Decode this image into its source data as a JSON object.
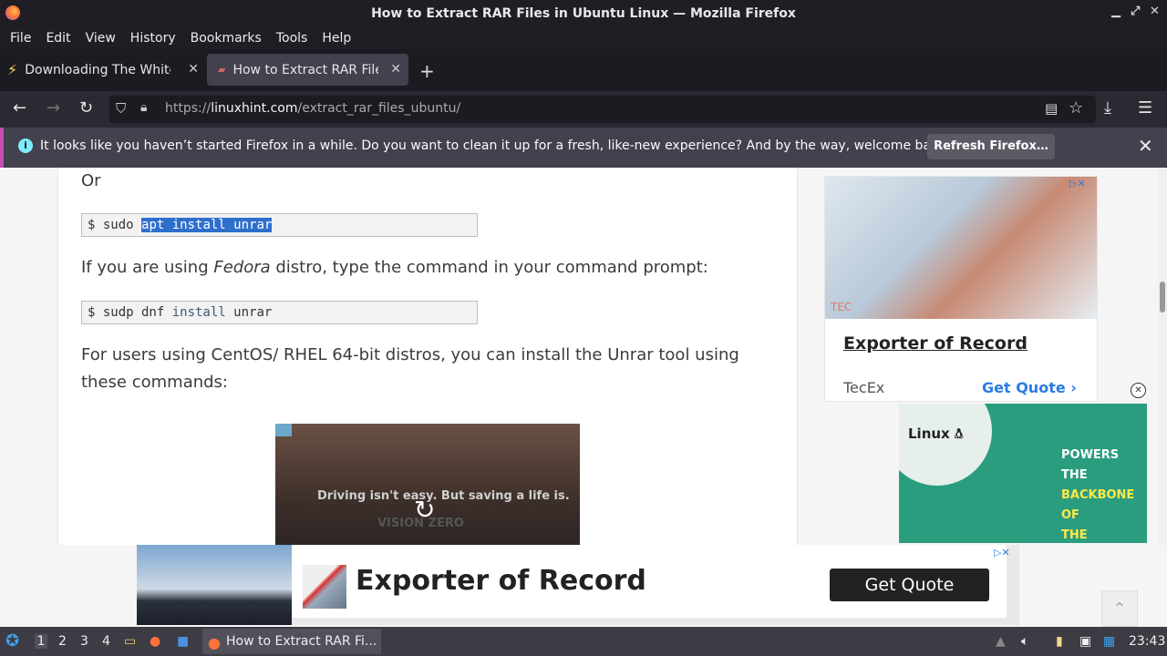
{
  "window": {
    "title": "How to Extract RAR Files in Ubuntu Linux — Mozilla Firefox"
  },
  "menu": [
    "File",
    "Edit",
    "View",
    "History",
    "Bookmarks",
    "Tools",
    "Help"
  ],
  "tabs": [
    {
      "label": "Downloading The White H"
    },
    {
      "label": "How to Extract RAR Files in Ubuntu Linux"
    }
  ],
  "url": {
    "host": "linuxhint.com",
    "scheme": "https://",
    "path": "/extract_rar_files_ubuntu/"
  },
  "notification": {
    "message": "It looks like you haven’t started Firefox in a while. Do you want to clean it up for a fresh, like-new experience? And by the way, welcome back!",
    "button": "Refresh Firefox…"
  },
  "article": {
    "or": "Or",
    "cmd1": {
      "prompt": "$ sudo ",
      "selected": "apt install unrar"
    },
    "fedora_pre": "If you are using ",
    "fedora_em": "Fedora",
    "fedora_post": " distro, type the command in your command prompt:",
    "cmd2": {
      "p1": "$ sudp dnf ",
      "kw": "install",
      "p2": " unrar"
    },
    "centos": "For users using CentOS/ RHEL 64-bit distros, you can install the Unrar tool using these commands:",
    "video": {
      "text": "Driving isn't easy. But saving a life is.",
      "brand": "VISION ZERO"
    }
  },
  "ads": {
    "side": {
      "tag": "TEC",
      "title": "Exporter of Record",
      "brand": "TecEx",
      "cta": "Get Quote"
    },
    "linux": {
      "logo": "Linux",
      "slogan1": "POWERS THE",
      "slogan2": "BACKBONE OF",
      "slogan3": "THE INTERNET"
    },
    "bottom": {
      "title": "Exporter of Record",
      "cta": "Get Quote"
    }
  },
  "taskbar": {
    "workspaces": [
      "1",
      "2",
      "3",
      "4"
    ],
    "task": "How to Extract RAR Fi...",
    "clock": "23:43"
  }
}
